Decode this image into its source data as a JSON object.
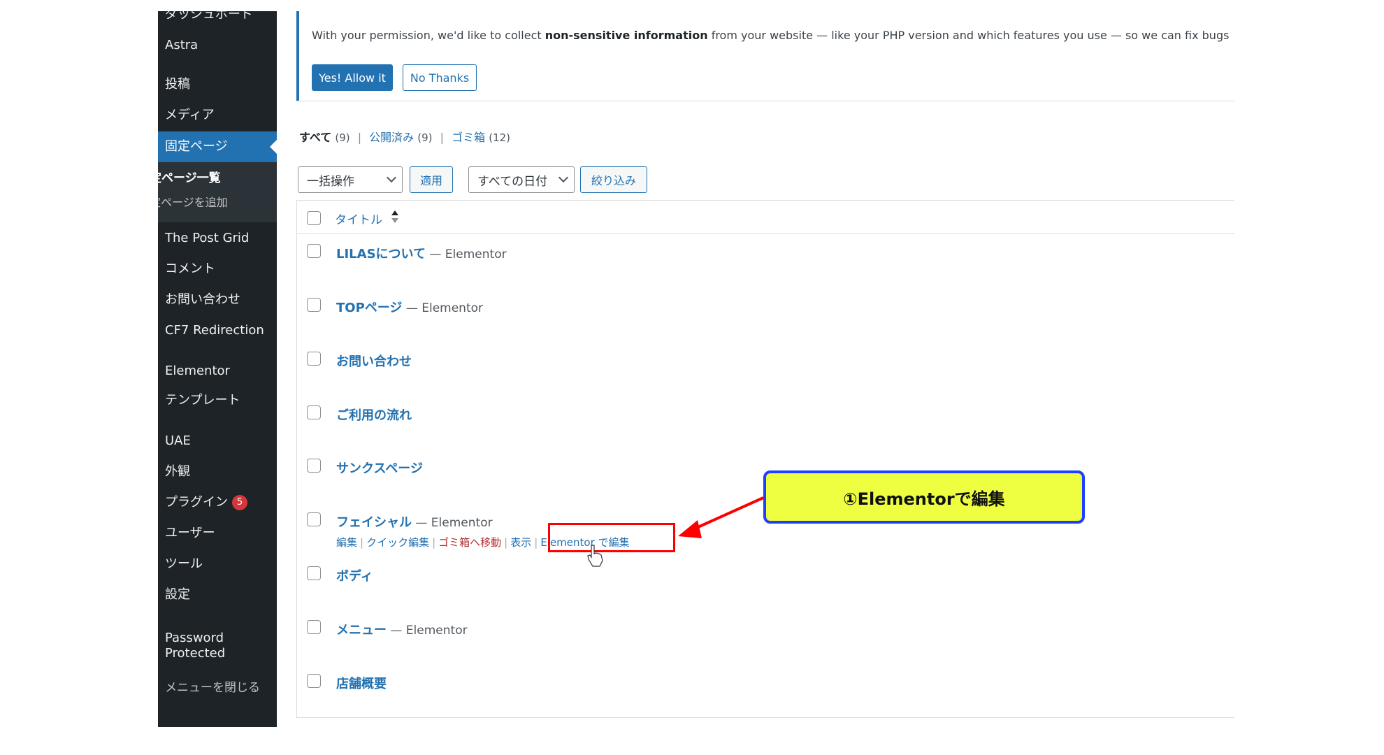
{
  "sidebar": {
    "items": [
      {
        "label": "ダッシュボード"
      },
      {
        "label": "Astra"
      },
      {
        "label": "投稿"
      },
      {
        "label": "メディア"
      },
      {
        "label": "固定ページ"
      },
      {
        "label": "The Post Grid"
      },
      {
        "label": "コメント"
      },
      {
        "label": "お問い合わせ"
      },
      {
        "label": "CF7 Redirection"
      },
      {
        "label": "Elementor"
      },
      {
        "label": "テンプレート"
      },
      {
        "label": "UAE"
      },
      {
        "label": "外観"
      },
      {
        "label": "プラグイン"
      },
      {
        "label": "ユーザー"
      },
      {
        "label": "ツール"
      },
      {
        "label": "設定"
      },
      {
        "label": "Password"
      },
      {
        "label": "Protected"
      },
      {
        "label": "メニューを閉じる"
      }
    ],
    "plugins_badge": "5",
    "submenu": {
      "all_pages": "定ページ一覧",
      "add_new": "定ページを追加"
    },
    "colors": {
      "background": "#1d2327",
      "active": "#2271b1"
    }
  },
  "notice": {
    "text_before": "With your permission, we'd like to collect ",
    "text_bold": "non-sensitive information",
    "text_after": " from your website — like your PHP version and which features you use — so we can fix bugs faster, make smar",
    "allow_label": "Yes! Allow it",
    "decline_label": "No Thanks"
  },
  "views": {
    "all_label": "すべて",
    "all_count": "(9)",
    "published_label": "公開済み",
    "published_count": "(9)",
    "trash_label": "ゴミ箱",
    "trash_count": "(12)"
  },
  "filters": {
    "bulk_action": "一括操作",
    "apply_label": "適用",
    "date_filter": "すべての日付",
    "filter_label": "絞り込み"
  },
  "table": {
    "title_header": "タイトル",
    "rows": [
      {
        "title": "LILASについて",
        "state": " — Elementor"
      },
      {
        "title": "TOPページ",
        "state": " — Elementor"
      },
      {
        "title": "お問い合わせ",
        "state": ""
      },
      {
        "title": "ご利用の流れ",
        "state": ""
      },
      {
        "title": "サンクスページ",
        "state": ""
      },
      {
        "title": "フェイシャル",
        "state": " — Elementor"
      },
      {
        "title": "ボディ",
        "state": ""
      },
      {
        "title": "メニュー",
        "state": " — Elementor"
      },
      {
        "title": "店舗概要",
        "state": ""
      }
    ],
    "row_actions": {
      "edit": "編集",
      "quick_edit": "クイック編集",
      "trash": "ゴミ箱へ移動",
      "view": "表示",
      "edit_elementor": "Elementor で編集"
    }
  },
  "annotation": {
    "callout_text": "①Elementorで編集",
    "colors": {
      "fill": "#eeff41",
      "border": "#1e40ff",
      "arrow": "#ff0000"
    }
  }
}
